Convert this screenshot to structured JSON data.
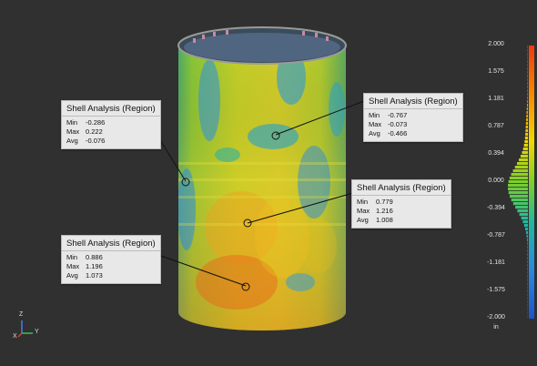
{
  "callouts": [
    {
      "title": "Shell Analysis (Region)",
      "min_label": "Min",
      "min": "-0.286",
      "max_label": "Max",
      "max": "0.222",
      "avg_label": "Avg",
      "avg": "-0.076"
    },
    {
      "title": "Shell Analysis (Region)",
      "min_label": "Min",
      "min": "-0.767",
      "max_label": "Max",
      "max": "-0.073",
      "avg_label": "Avg",
      "avg": "-0.466"
    },
    {
      "title": "Shell Analysis (Region)",
      "min_label": "Min",
      "min": "0.779",
      "max_label": "Max",
      "max": "1.216",
      "avg_label": "Avg",
      "avg": "1.008"
    },
    {
      "title": "Shell Analysis (Region)",
      "min_label": "Min",
      "min": "0.886",
      "max_label": "Max",
      "max": "1.196",
      "avg_label": "Avg",
      "avg": "1.073"
    }
  ],
  "color_scale": {
    "labels": [
      "2.000",
      "1.575",
      "1.181",
      "0.787",
      "0.394",
      "0.000",
      "-0.394",
      "-0.787",
      "-1.181",
      "-1.575",
      "-2.000"
    ],
    "unit": "in",
    "colors": [
      "#f04010",
      "#f7a000",
      "#f0e000",
      "#6cd030",
      "#1fb7a8",
      "#2a7fe0"
    ]
  },
  "axes": {
    "z": "Z",
    "x": "X",
    "y": "Y"
  }
}
